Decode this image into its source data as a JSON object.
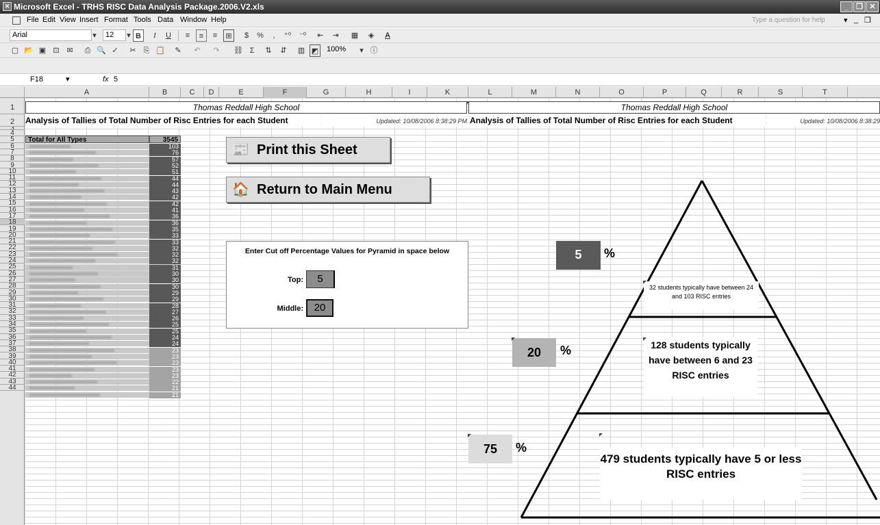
{
  "window": {
    "title": "Microsoft Excel - TRHS RISC Data Analysis Package.2006.V2.xls"
  },
  "menu": {
    "items": [
      "File",
      "Edit",
      "View",
      "Insert",
      "Format",
      "Tools",
      "Data",
      "Window",
      "Help"
    ],
    "help_placeholder": "Type a question for help"
  },
  "toolbar": {
    "font": "Arial",
    "size": "12",
    "zoom": "100%",
    "bold": "B",
    "italic": "I",
    "underline": "U",
    "currency": "$",
    "percent": "%",
    "comma": ","
  },
  "formula": {
    "name_box": "F18",
    "fx": "fx",
    "value": "5"
  },
  "columns": [
    "A",
    "B",
    "C",
    "D",
    "E",
    "F",
    "G",
    "H",
    "I",
    "K",
    "L",
    "M",
    "N",
    "O",
    "P",
    "Q",
    "R",
    "S",
    "T"
  ],
  "rows": [
    "1",
    "2",
    "3",
    "4",
    "5",
    "6",
    "7",
    "8",
    "9",
    "10",
    "11",
    "12",
    "13",
    "14",
    "15",
    "16",
    "17",
    "18",
    "19",
    "20",
    "21",
    "22",
    "23",
    "24",
    "25",
    "26",
    "27",
    "28",
    "29",
    "30",
    "31",
    "32",
    "33",
    "34",
    "35",
    "36",
    "37",
    "38",
    "39",
    "40",
    "41",
    "42",
    "43",
    "44"
  ],
  "sheet": {
    "school_left": "Thomas Reddall High School",
    "school_right": "Thomas Reddall High School",
    "heading_left": "Analysis of Tallies of Total Number of Risc Entries for each Student",
    "heading_right": "Analysis of Tallies of Total Number of Risc Entries for each Student",
    "updated_left": "Updated: 10/08/2006 8:38:29 PM",
    "updated_right": "Updated: 10/08/2006 8:38:29",
    "total_label": "Total for All Types",
    "total_value": "3545",
    "values": [
      "103",
      "76",
      "57",
      "52",
      "51",
      "44",
      "44",
      "43",
      "42",
      "42",
      "41",
      "36",
      "36",
      "35",
      "33",
      "33",
      "32",
      "32",
      "32",
      "31",
      "30",
      "30",
      "30",
      "29",
      "29",
      "28",
      "27",
      "26",
      "25",
      "25",
      "24",
      "24",
      "23",
      "23",
      "23",
      "23",
      "23",
      "22",
      "21",
      "21"
    ]
  },
  "buttons": {
    "print": "Print this Sheet",
    "return": "Return to Main Menu"
  },
  "cutoff": {
    "title": "Enter Cut off Percentage Values for Pyramid in space below",
    "top_label": "Top:",
    "top_value": "5",
    "middle_label": "Middle:",
    "middle_value": "20"
  },
  "pyramid": {
    "top_pct": "5",
    "middle_pct": "20",
    "bottom_pct": "75",
    "pct_sign": "%",
    "top_text": "32 students typically have between 24 and 103 RISC entries",
    "middle_text": "128 students typically have between 6 and 23 RISC entries",
    "bottom_text": "479 students typically have 5 or less RISC entries"
  },
  "colors": {
    "dark_fill": "#585858",
    "light_fill": "#a4a4a4",
    "top_fill": "#5a5a5a",
    "middle_fill": "#b4b4b4",
    "bottom_fill": "#dcdcdc"
  }
}
